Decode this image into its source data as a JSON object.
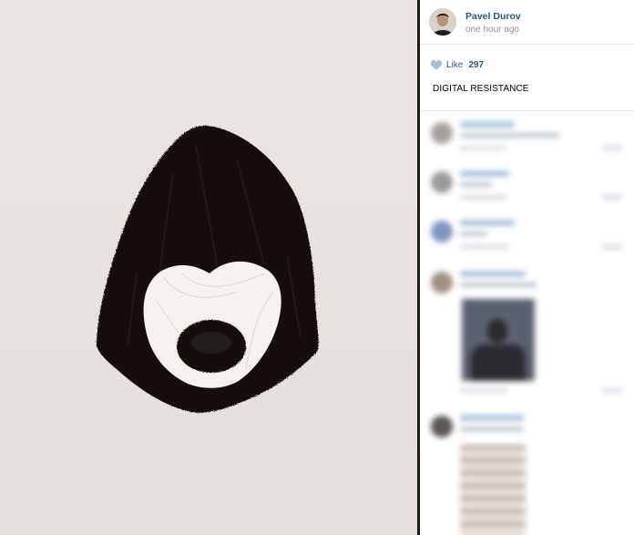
{
  "post": {
    "author_name": "Pavel Durov",
    "timestamp": "one hour ago",
    "like_label": "Like",
    "like_count": "297",
    "caption": "DIGITAL RESISTANCE"
  },
  "colors": {
    "link": "#2a5885",
    "muted": "#939393",
    "heart": "#a8bed6",
    "divider": "#1c1c1c"
  },
  "icons": {
    "like": "heart-icon"
  }
}
